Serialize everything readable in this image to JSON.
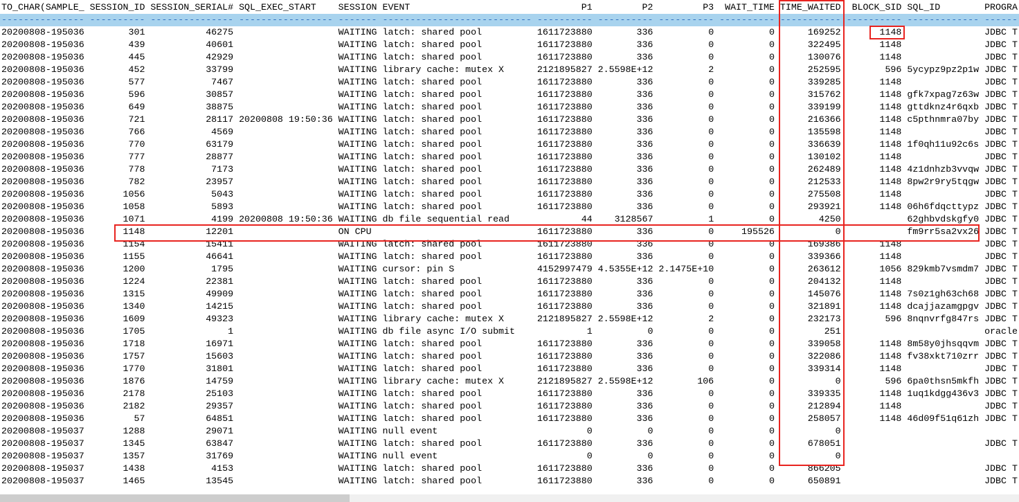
{
  "columns": [
    {
      "key": "to_char",
      "header": "TO_CHAR(SAMPLE_",
      "width": 15,
      "align": "l"
    },
    {
      "key": "session_id",
      "header": "SESSION_ID",
      "width": 10,
      "align": "r"
    },
    {
      "key": "session_serial",
      "header": "SESSION_SERIAL#",
      "width": 15,
      "align": "r"
    },
    {
      "key": "sql_exec_start",
      "header": "SQL_EXEC_START",
      "width": 17,
      "align": "l"
    },
    {
      "key": "session",
      "header": "SESSION",
      "width": 7,
      "align": "l"
    },
    {
      "key": "event",
      "header": "EVENT",
      "width": 27,
      "align": "l"
    },
    {
      "key": "p1",
      "header": "P1",
      "width": 10,
      "align": "r"
    },
    {
      "key": "p2",
      "header": "P2",
      "width": 10,
      "align": "r"
    },
    {
      "key": "p3",
      "header": "P3",
      "width": 10,
      "align": "r"
    },
    {
      "key": "wait_time",
      "header": "WAIT_TIME",
      "width": 10,
      "align": "r"
    },
    {
      "key": "time_waited",
      "header": "TIME_WAITED",
      "width": 11,
      "align": "r"
    },
    {
      "key": "block_sid",
      "header": "BLOCK_SID",
      "width": 10,
      "align": "r"
    },
    {
      "key": "sql_id",
      "header": "SQL_ID",
      "width": 13,
      "align": "l"
    },
    {
      "key": "program",
      "header": "PROGRA",
      "width": 15,
      "align": "l"
    }
  ],
  "rows": [
    [
      "20200808-195036",
      "301",
      "46275",
      "",
      "WAITING",
      "latch: shared pool",
      "1611723880",
      "336",
      "0",
      "0",
      "169252",
      "1148",
      "",
      "JDBC T"
    ],
    [
      "20200808-195036",
      "439",
      "40601",
      "",
      "WAITING",
      "latch: shared pool",
      "1611723880",
      "336",
      "0",
      "0",
      "322495",
      "1148",
      "",
      "JDBC T"
    ],
    [
      "20200808-195036",
      "445",
      "42929",
      "",
      "WAITING",
      "latch: shared pool",
      "1611723880",
      "336",
      "0",
      "0",
      "130076",
      "1148",
      "",
      "JDBC T"
    ],
    [
      "20200808-195036",
      "452",
      "33799",
      "",
      "WAITING",
      "library cache: mutex X",
      "2121895827",
      "2.5598E+12",
      "2",
      "0",
      "252595",
      "596",
      "5ycypz9pz2p1w",
      "JDBC T"
    ],
    [
      "20200808-195036",
      "577",
      "7467",
      "",
      "WAITING",
      "latch: shared pool",
      "1611723880",
      "336",
      "0",
      "0",
      "339285",
      "1148",
      "",
      "JDBC T"
    ],
    [
      "20200808-195036",
      "596",
      "30857",
      "",
      "WAITING",
      "latch: shared pool",
      "1611723880",
      "336",
      "0",
      "0",
      "315762",
      "1148",
      "gfk7xpag7z63w",
      "JDBC T"
    ],
    [
      "20200808-195036",
      "649",
      "38875",
      "",
      "WAITING",
      "latch: shared pool",
      "1611723880",
      "336",
      "0",
      "0",
      "339199",
      "1148",
      "gttdknz4r6qxb",
      "JDBC T"
    ],
    [
      "20200808-195036",
      "721",
      "28117",
      "20200808 19:50:36",
      "WAITING",
      "latch: shared pool",
      "1611723880",
      "336",
      "0",
      "0",
      "216366",
      "1148",
      "c5pthnmra07by",
      "JDBC T"
    ],
    [
      "20200808-195036",
      "766",
      "4569",
      "",
      "WAITING",
      "latch: shared pool",
      "1611723880",
      "336",
      "0",
      "0",
      "135598",
      "1148",
      "",
      "JDBC T"
    ],
    [
      "20200808-195036",
      "770",
      "63179",
      "",
      "WAITING",
      "latch: shared pool",
      "1611723880",
      "336",
      "0",
      "0",
      "336639",
      "1148",
      "1f0qh11u92c6s",
      "JDBC T"
    ],
    [
      "20200808-195036",
      "777",
      "28877",
      "",
      "WAITING",
      "latch: shared pool",
      "1611723880",
      "336",
      "0",
      "0",
      "130102",
      "1148",
      "",
      "JDBC T"
    ],
    [
      "20200808-195036",
      "778",
      "7173",
      "",
      "WAITING",
      "latch: shared pool",
      "1611723880",
      "336",
      "0",
      "0",
      "262489",
      "1148",
      "4z1dnhzb3vvqw",
      "JDBC T"
    ],
    [
      "20200808-195036",
      "782",
      "23957",
      "",
      "WAITING",
      "latch: shared pool",
      "1611723880",
      "336",
      "0",
      "0",
      "212533",
      "1148",
      "8pw2r9ry5tqgw",
      "JDBC T"
    ],
    [
      "20200808-195036",
      "1056",
      "5043",
      "",
      "WAITING",
      "latch: shared pool",
      "1611723880",
      "336",
      "0",
      "0",
      "275508",
      "1148",
      "",
      "JDBC T"
    ],
    [
      "20200808-195036",
      "1058",
      "5893",
      "",
      "WAITING",
      "latch: shared pool",
      "1611723880",
      "336",
      "0",
      "0",
      "293921",
      "1148",
      "06h6fdqcttypz",
      "JDBC T"
    ],
    [
      "20200808-195036",
      "1071",
      "4199",
      "20200808 19:50:36",
      "WAITING",
      "db file sequential read",
      "44",
      "3128567",
      "1",
      "0",
      "4250",
      "",
      "62ghbvdskgfy0",
      "JDBC T"
    ],
    [
      "20200808-195036",
      "1148",
      "12201",
      "",
      "ON CPU",
      "",
      "1611723880",
      "336",
      "0",
      "195526",
      "0",
      "",
      "fm9rr5sa2vx26",
      "JDBC T"
    ],
    [
      "20200808-195036",
      "1154",
      "15411",
      "",
      "WAITING",
      "latch: shared pool",
      "1611723880",
      "336",
      "0",
      "0",
      "169386",
      "1148",
      "",
      "JDBC T"
    ],
    [
      "20200808-195036",
      "1155",
      "46641",
      "",
      "WAITING",
      "latch: shared pool",
      "1611723880",
      "336",
      "0",
      "0",
      "339366",
      "1148",
      "",
      "JDBC T"
    ],
    [
      "20200808-195036",
      "1200",
      "1795",
      "",
      "WAITING",
      "cursor: pin S",
      "4152997479",
      "4.5355E+12",
      "2.1475E+10",
      "0",
      "263612",
      "1056",
      "829kmb7vsmdm7",
      "JDBC T"
    ],
    [
      "20200808-195036",
      "1224",
      "22381",
      "",
      "WAITING",
      "latch: shared pool",
      "1611723880",
      "336",
      "0",
      "0",
      "204132",
      "1148",
      "",
      "JDBC T"
    ],
    [
      "20200808-195036",
      "1315",
      "49909",
      "",
      "WAITING",
      "latch: shared pool",
      "1611723880",
      "336",
      "0",
      "0",
      "145076",
      "1148",
      "7s0z1gh63ch68",
      "JDBC T"
    ],
    [
      "20200808-195036",
      "1340",
      "14215",
      "",
      "WAITING",
      "latch: shared pool",
      "1611723880",
      "336",
      "0",
      "0",
      "321891",
      "1148",
      "dcajjazamgpgv",
      "JDBC T"
    ],
    [
      "20200808-195036",
      "1609",
      "49323",
      "",
      "WAITING",
      "library cache: mutex X",
      "2121895827",
      "2.5598E+12",
      "2",
      "0",
      "232173",
      "596",
      "8nqnvrfg847rs",
      "JDBC T"
    ],
    [
      "20200808-195036",
      "1705",
      "1",
      "",
      "WAITING",
      "db file async I/O submit",
      "1",
      "0",
      "0",
      "0",
      "251",
      "",
      "",
      "oracle"
    ],
    [
      "20200808-195036",
      "1718",
      "16971",
      "",
      "WAITING",
      "latch: shared pool",
      "1611723880",
      "336",
      "0",
      "0",
      "339058",
      "1148",
      "8m58y0jhsqqvm",
      "JDBC T"
    ],
    [
      "20200808-195036",
      "1757",
      "15603",
      "",
      "WAITING",
      "latch: shared pool",
      "1611723880",
      "336",
      "0",
      "0",
      "322086",
      "1148",
      "fv38xkt710zrr",
      "JDBC T"
    ],
    [
      "20200808-195036",
      "1770",
      "31801",
      "",
      "WAITING",
      "latch: shared pool",
      "1611723880",
      "336",
      "0",
      "0",
      "339314",
      "1148",
      "",
      "JDBC T"
    ],
    [
      "20200808-195036",
      "1876",
      "14759",
      "",
      "WAITING",
      "library cache: mutex X",
      "2121895827",
      "2.5598E+12",
      "106",
      "0",
      "0",
      "596",
      "6pa0thsn5mkfh",
      "JDBC T"
    ],
    [
      "20200808-195036",
      "2178",
      "25103",
      "",
      "WAITING",
      "latch: shared pool",
      "1611723880",
      "336",
      "0",
      "0",
      "339335",
      "1148",
      "1uq1kdgg436v3",
      "JDBC T"
    ],
    [
      "20200808-195036",
      "2182",
      "29357",
      "",
      "WAITING",
      "latch: shared pool",
      "1611723880",
      "336",
      "0",
      "0",
      "212894",
      "1148",
      "",
      "JDBC T"
    ],
    [
      "20200808-195036",
      "57",
      "64851",
      "",
      "WAITING",
      "latch: shared pool",
      "1611723880",
      "336",
      "0",
      "0",
      "258057",
      "1148",
      "46d09f51q61zh",
      "JDBC T"
    ],
    [
      "20200808-195037",
      "1288",
      "29071",
      "",
      "WAITING",
      "null event",
      "0",
      "0",
      "0",
      "0",
      "0",
      "",
      "",
      ""
    ],
    [
      "20200808-195037",
      "1345",
      "63847",
      "",
      "WAITING",
      "latch: shared pool",
      "1611723880",
      "336",
      "0",
      "0",
      "678051",
      "",
      "",
      "JDBC T"
    ],
    [
      "20200808-195037",
      "1357",
      "31769",
      "",
      "WAITING",
      "null event",
      "0",
      "0",
      "0",
      "0",
      "0",
      "",
      "",
      ""
    ],
    [
      "20200808-195037",
      "1438",
      "4153",
      "",
      "WAITING",
      "latch: shared pool",
      "1611723880",
      "336",
      "0",
      "0",
      "866205",
      "",
      "",
      "JDBC T"
    ],
    [
      "20200808-195037",
      "1465",
      "13545",
      "",
      "WAITING",
      "latch: shared pool",
      "1611723880",
      "336",
      "0",
      "0",
      "650891",
      "",
      "",
      "JDBC T"
    ]
  ],
  "colors": {
    "highlight_box": "#e8231f",
    "separator_band": "#a8d3ee",
    "separator_dash": "#2f6fc0"
  }
}
